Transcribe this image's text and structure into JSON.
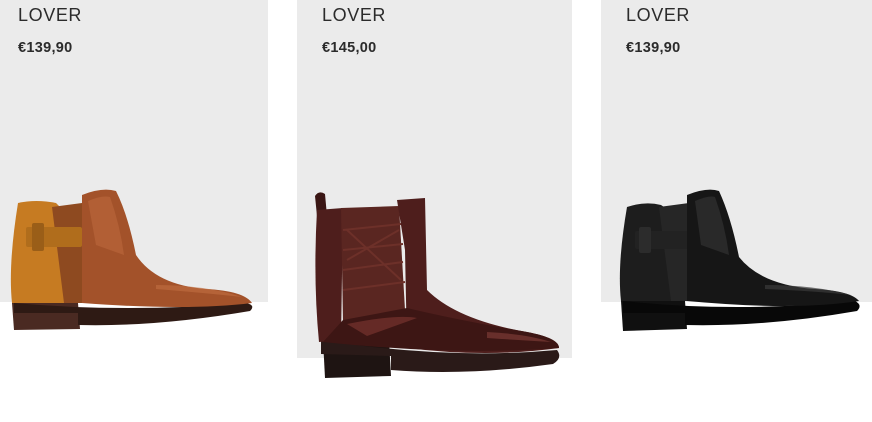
{
  "products": [
    {
      "brand": "LOVER",
      "price": "€139,90",
      "image_icon": "brown-ankle-boot-icon",
      "colors": {
        "leather": "#a3522a",
        "suede": "#c67b22",
        "sole": "#4a2a22"
      }
    },
    {
      "brand": "LOVER",
      "price": "€145,00",
      "image_icon": "burgundy-chelsea-boot-icon",
      "colors": {
        "leather": "#4e1e1c",
        "elastic": "#5a2621",
        "sole": "#2a1a18"
      }
    },
    {
      "brand": "LOVER",
      "price": "€139,90",
      "image_icon": "black-ankle-boot-icon",
      "colors": {
        "leather": "#161616",
        "suede": "#1d1d1d",
        "sole": "#101010"
      }
    }
  ],
  "colors": {
    "card_background": "#ebebeb",
    "text": "#2b2b2b",
    "page_background": "#ffffff"
  }
}
